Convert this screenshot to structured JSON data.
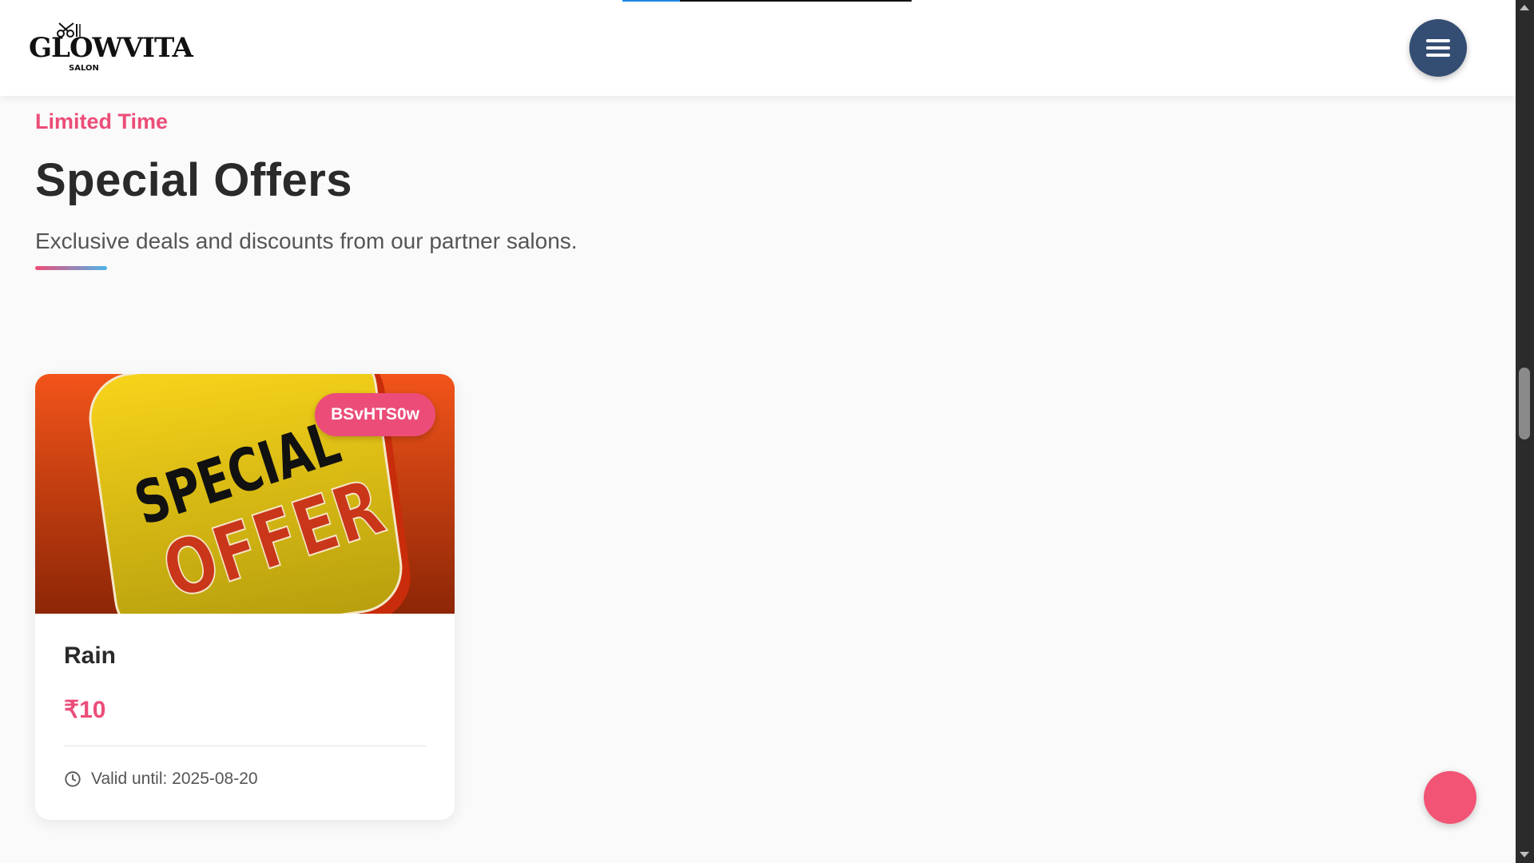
{
  "header": {
    "logo_text": "GLOWVITA",
    "logo_sub": "SALON",
    "menu_icon": "hamburger-icon",
    "progress": 0.2
  },
  "section": {
    "eyebrow": "Limited Time",
    "title": "Special Offers",
    "subtitle": "Exclusive deals and discounts from our partner salons."
  },
  "offers": [
    {
      "code": "BSvHTS0w",
      "image_text_top": "SPECIAL",
      "image_text_bottom": "OFFER",
      "name": "Rain",
      "price": "₹10",
      "valid_until": "Valid until: 2025-08-20",
      "clock_icon": "clock-icon"
    }
  ],
  "colors": {
    "accent": "#ec4d78",
    "menu_button": "#344d73",
    "fab": "#f25475",
    "progress": "#1e88e5"
  }
}
